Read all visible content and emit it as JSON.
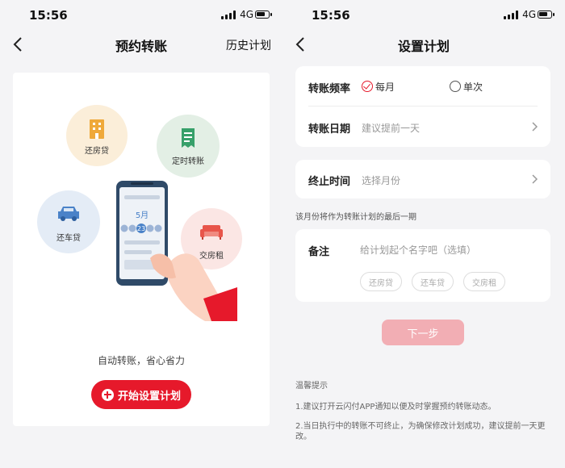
{
  "left": {
    "status": {
      "time": "15:56",
      "network": "4G"
    },
    "nav": {
      "title": "预约转账",
      "right_link": "历史计划"
    },
    "bubbles": {
      "mortgage": "还房贷",
      "scheduled": "定时转账",
      "car_loan": "还车贷",
      "rent": "交房租"
    },
    "phone": {
      "month": "5月",
      "day": "23"
    },
    "slogan": "自动转账，省心省力",
    "start_button": "开始设置计划"
  },
  "right": {
    "status": {
      "time": "15:56",
      "network": "4G"
    },
    "nav": {
      "title": "设置计划"
    },
    "frequency": {
      "label": "转账频率",
      "options": [
        "每月",
        "单次"
      ],
      "selected": "每月"
    },
    "date": {
      "label": "转账日期",
      "placeholder": "建议提前一天"
    },
    "end_time": {
      "label": "终止时间",
      "placeholder": "选择月份"
    },
    "end_hint": "该月份将作为转账计划的最后一期",
    "note": {
      "label": "备注",
      "placeholder": "给计划起个名字吧（选填）",
      "chips": [
        "还房贷",
        "还车贷",
        "交房租"
      ]
    },
    "next_button": "下一步",
    "tips": {
      "title": "温馨提示",
      "items": [
        "1.建议打开云闪付APP通知以便及时掌握预约转账动态。",
        "2.当日执行中的转账不可终止，为确保修改计划成功，建议提前一天更改。"
      ]
    }
  },
  "colors": {
    "brand_red": "#e6192b",
    "disabled_red": "#f2aeb4"
  }
}
